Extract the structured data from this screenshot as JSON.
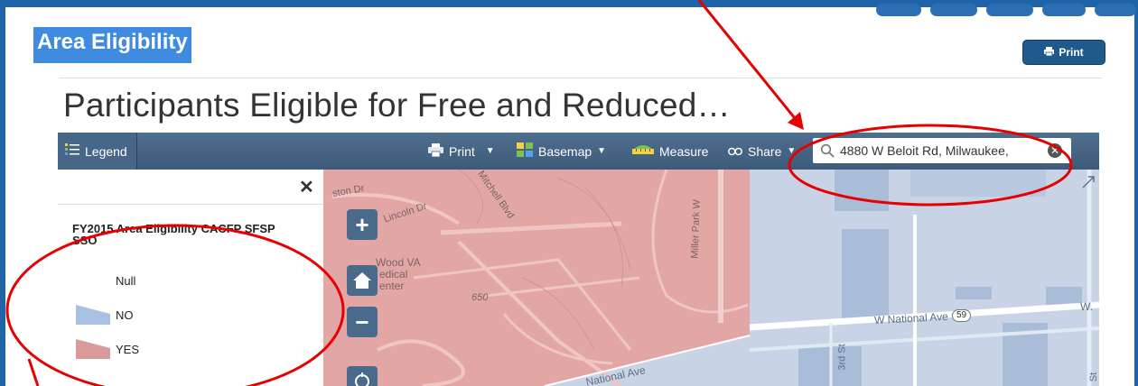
{
  "page": {
    "heading": "Area Eligibility",
    "print_label": "Print",
    "map_title": "Participants Eligible for Free and Reduced…"
  },
  "toolbar": {
    "legend_label": "Legend",
    "print_label": "Print",
    "basemap_label": "Basemap",
    "measure_label": "Measure",
    "share_label": "Share",
    "search_value": "4880 W Beloit Rd, Milwaukee,"
  },
  "legend": {
    "layer_title": "FY2015 Area Eligibility CACFP SFSP SSO",
    "items": [
      {
        "label": "Null",
        "color": ""
      },
      {
        "label": "NO",
        "color": "#a9c0e0"
      },
      {
        "label": "YES",
        "color": "#d99a9a"
      }
    ]
  },
  "map": {
    "labels": {
      "lincoln_dr": "Lincoln Dr",
      "ston_dr": "ston Dr",
      "mitchell_blvd": "Mitchell Blvd",
      "miller_park_way": "Miller Park W",
      "wood_va": "Wood VA",
      "medical": "edical",
      "center": "enter",
      "elev": "650",
      "w_national_ave": "W National Ave",
      "route_59": "59",
      "national_ave_bottom": "National Ave",
      "third_st": "3rd St",
      "w_right": "W.",
      "st_right": "St"
    }
  },
  "colors": {
    "frame_blue": "#1f63a8",
    "heading_highlight": "#3f8be0",
    "toolbar": "#4a6a8b",
    "eligible_yes": "#d99a9a",
    "eligible_no": "#a9c0e0",
    "annotation_red": "#e60000"
  }
}
